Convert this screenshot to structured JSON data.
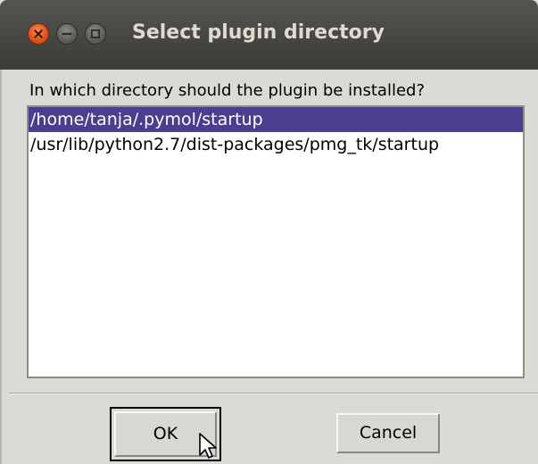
{
  "window": {
    "title": "Select plugin directory",
    "controls": [
      "close-icon",
      "minimize-icon",
      "maximize-icon"
    ]
  },
  "dialog": {
    "prompt": "In which directory should the plugin be installed?",
    "directories": [
      {
        "path": "/home/tanja/.pymol/startup",
        "selected": true
      },
      {
        "path": "/usr/lib/python2.7/dist-packages/pmg_tk/startup",
        "selected": false
      }
    ],
    "ok_label": "OK",
    "cancel_label": "Cancel"
  },
  "colors": {
    "titlebar": "#3c3b37",
    "selection": "#4a3f8f",
    "close_button": "#e0531d",
    "dialog_bg": "#dcdad5"
  }
}
